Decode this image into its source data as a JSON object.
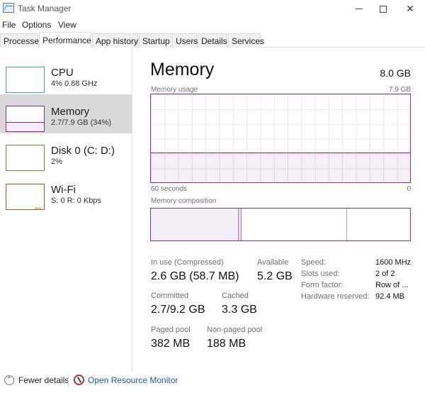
{
  "window": {
    "title": "Task Manager",
    "icon": "task-manager-icon"
  },
  "menu": [
    "File",
    "Options",
    "View"
  ],
  "tabs": [
    "Processes",
    "Performance",
    "App history",
    "Startup",
    "Users",
    "Details",
    "Services"
  ],
  "active_tab": "Performance",
  "sidebar": {
    "items": [
      {
        "title": "CPU",
        "subtitle": "4% 0.88 GHz",
        "color": "#4a9fd1"
      },
      {
        "title": "Memory",
        "subtitle": "2.7/7.9 GB (34%)",
        "color": "#8b2d9c"
      },
      {
        "title": "Disk 0 (C: D:)",
        "subtitle": "2%",
        "color": "#4ea033"
      },
      {
        "title": "Wi-Fi",
        "subtitle": "S: 0 R: 0 Kbps",
        "color": "#a5571b"
      }
    ],
    "selected": "Memory"
  },
  "main": {
    "title": "Memory",
    "total": "8.0 GB",
    "usage_label": "Memory usage",
    "usage_max": "7.9 GB",
    "usage_fraction": 0.34,
    "time_left": "60 seconds",
    "time_right": "0",
    "composition_label": "Memory composition",
    "composition": {
      "in_use_fraction": 0.34,
      "standby_end_fraction": 0.756
    },
    "stats": {
      "in_use_label": "In use (Compressed)",
      "in_use_value": "2.6 GB (58.7 MB)",
      "available_label": "Available",
      "available_value": "5.2 GB",
      "committed_label": "Committed",
      "committed_value": "2.7/9.2 GB",
      "cached_label": "Cached",
      "cached_value": "3.3 GB",
      "paged_label": "Paged pool",
      "paged_value": "382 MB",
      "nonpaged_label": "Non-paged pool",
      "nonpaged_value": "188 MB"
    },
    "details": [
      {
        "key": "Speed:",
        "value": "1600 MHz"
      },
      {
        "key": "Slots used:",
        "value": "2 of 2"
      },
      {
        "key": "Form factor:",
        "value": "Row of ..."
      },
      {
        "key": "Hardware reserved:",
        "value": "92.4 MB"
      }
    ]
  },
  "footer": {
    "fewer_details": "Fewer details",
    "resource_monitor": "Open Resource Monitor"
  }
}
